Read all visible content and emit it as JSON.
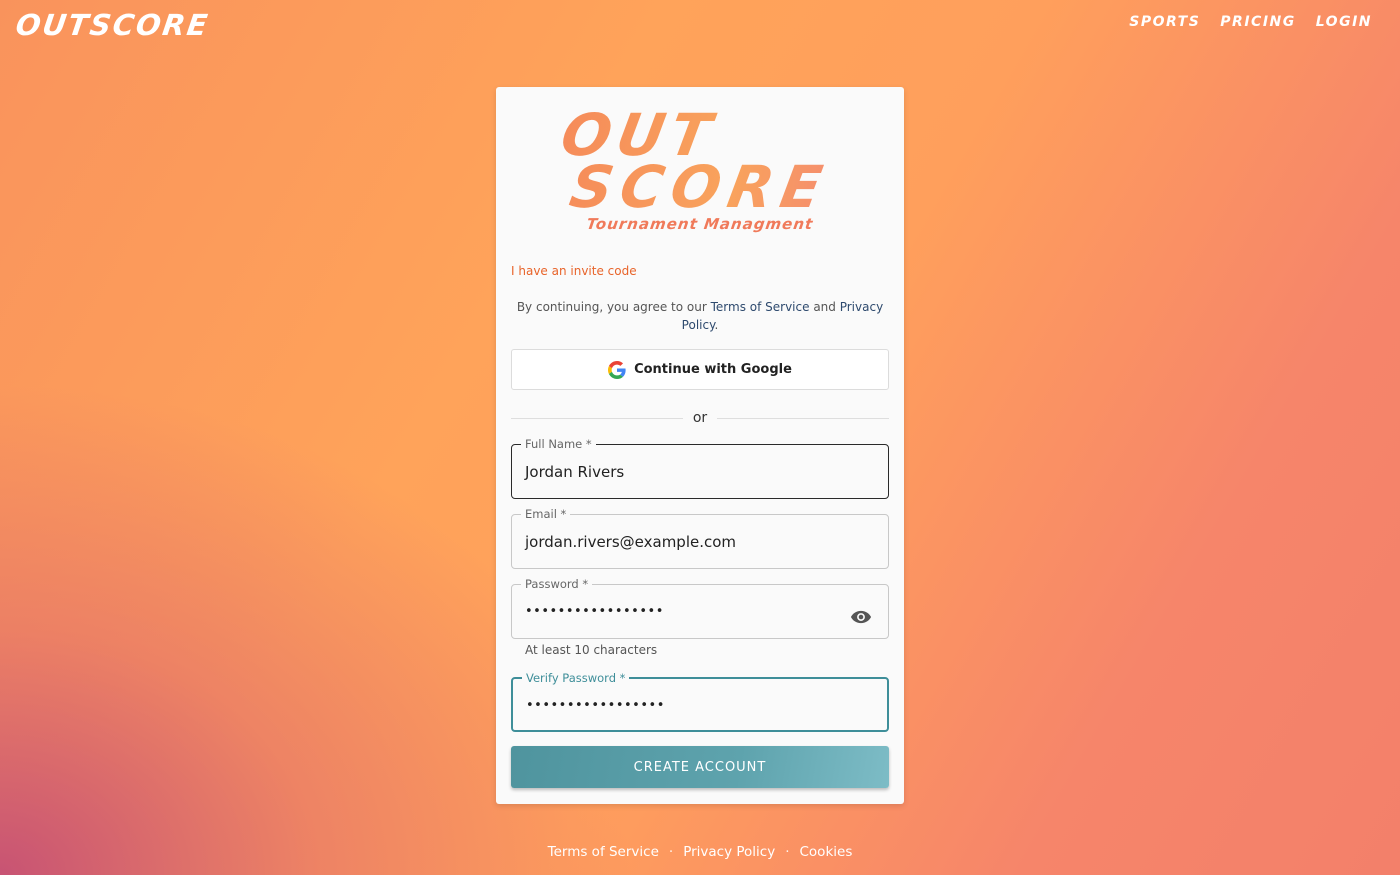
{
  "header": {
    "brand": "OUTSCORE",
    "nav": [
      "SPORTS",
      "PRICING",
      "LOGIN"
    ]
  },
  "card": {
    "logo_line1": "OUT",
    "logo_line2": "SCORE",
    "logo_tagline": "Tournament Managment",
    "invite_link": "I have an invite code",
    "agree_prefix": "By continuing, you agree to our ",
    "terms_link": "Terms of Service",
    "agree_and": " and ",
    "privacy_link": "Privacy Policy",
    "agree_suffix": ".",
    "google_button": "Continue with Google",
    "divider": "or",
    "fields": {
      "full_name": {
        "label": "Full Name *",
        "value": "Jordan Rivers"
      },
      "email": {
        "label": "Email *",
        "value": "jordan.rivers@example.com"
      },
      "password": {
        "label": "Password *",
        "value": "•••••••••••••••••",
        "hint": "At least 10 characters"
      },
      "verify": {
        "label": "Verify Password *",
        "value": "•••••••••••••••••"
      }
    },
    "create_button": "CREATE ACCOUNT"
  },
  "footer": {
    "links": [
      "Terms of Service",
      "Privacy Policy",
      "Cookies"
    ],
    "separator": "·"
  },
  "colors": {
    "accent_teal": "#4f949e",
    "invite_orange": "#e8642a",
    "link_navy": "#2e4a6e"
  }
}
